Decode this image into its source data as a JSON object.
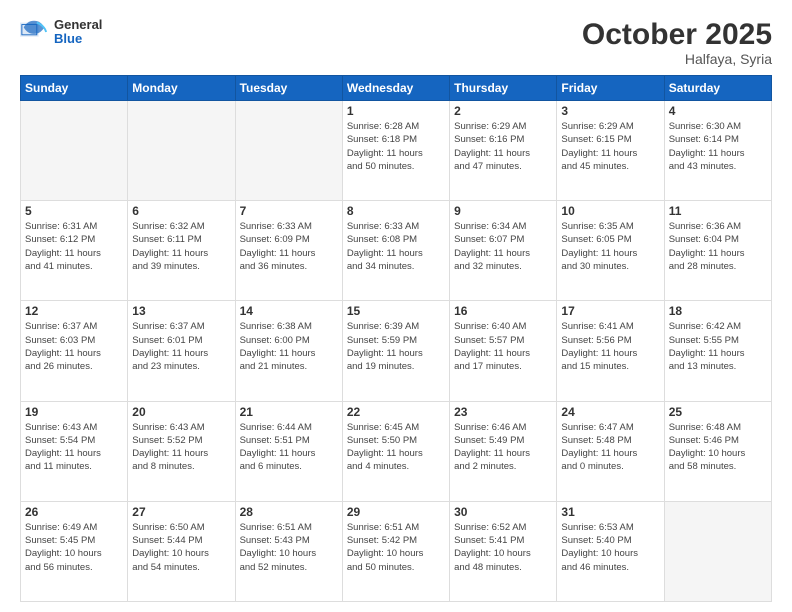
{
  "header": {
    "logo_general": "General",
    "logo_blue": "Blue",
    "month_title": "October 2025",
    "location": "Halfaya, Syria"
  },
  "days_of_week": [
    "Sunday",
    "Monday",
    "Tuesday",
    "Wednesday",
    "Thursday",
    "Friday",
    "Saturday"
  ],
  "weeks": [
    [
      {
        "day": "",
        "info": ""
      },
      {
        "day": "",
        "info": ""
      },
      {
        "day": "",
        "info": ""
      },
      {
        "day": "1",
        "info": "Sunrise: 6:28 AM\nSunset: 6:18 PM\nDaylight: 11 hours\nand 50 minutes."
      },
      {
        "day": "2",
        "info": "Sunrise: 6:29 AM\nSunset: 6:16 PM\nDaylight: 11 hours\nand 47 minutes."
      },
      {
        "day": "3",
        "info": "Sunrise: 6:29 AM\nSunset: 6:15 PM\nDaylight: 11 hours\nand 45 minutes."
      },
      {
        "day": "4",
        "info": "Sunrise: 6:30 AM\nSunset: 6:14 PM\nDaylight: 11 hours\nand 43 minutes."
      }
    ],
    [
      {
        "day": "5",
        "info": "Sunrise: 6:31 AM\nSunset: 6:12 PM\nDaylight: 11 hours\nand 41 minutes."
      },
      {
        "day": "6",
        "info": "Sunrise: 6:32 AM\nSunset: 6:11 PM\nDaylight: 11 hours\nand 39 minutes."
      },
      {
        "day": "7",
        "info": "Sunrise: 6:33 AM\nSunset: 6:09 PM\nDaylight: 11 hours\nand 36 minutes."
      },
      {
        "day": "8",
        "info": "Sunrise: 6:33 AM\nSunset: 6:08 PM\nDaylight: 11 hours\nand 34 minutes."
      },
      {
        "day": "9",
        "info": "Sunrise: 6:34 AM\nSunset: 6:07 PM\nDaylight: 11 hours\nand 32 minutes."
      },
      {
        "day": "10",
        "info": "Sunrise: 6:35 AM\nSunset: 6:05 PM\nDaylight: 11 hours\nand 30 minutes."
      },
      {
        "day": "11",
        "info": "Sunrise: 6:36 AM\nSunset: 6:04 PM\nDaylight: 11 hours\nand 28 minutes."
      }
    ],
    [
      {
        "day": "12",
        "info": "Sunrise: 6:37 AM\nSunset: 6:03 PM\nDaylight: 11 hours\nand 26 minutes."
      },
      {
        "day": "13",
        "info": "Sunrise: 6:37 AM\nSunset: 6:01 PM\nDaylight: 11 hours\nand 23 minutes."
      },
      {
        "day": "14",
        "info": "Sunrise: 6:38 AM\nSunset: 6:00 PM\nDaylight: 11 hours\nand 21 minutes."
      },
      {
        "day": "15",
        "info": "Sunrise: 6:39 AM\nSunset: 5:59 PM\nDaylight: 11 hours\nand 19 minutes."
      },
      {
        "day": "16",
        "info": "Sunrise: 6:40 AM\nSunset: 5:57 PM\nDaylight: 11 hours\nand 17 minutes."
      },
      {
        "day": "17",
        "info": "Sunrise: 6:41 AM\nSunset: 5:56 PM\nDaylight: 11 hours\nand 15 minutes."
      },
      {
        "day": "18",
        "info": "Sunrise: 6:42 AM\nSunset: 5:55 PM\nDaylight: 11 hours\nand 13 minutes."
      }
    ],
    [
      {
        "day": "19",
        "info": "Sunrise: 6:43 AM\nSunset: 5:54 PM\nDaylight: 11 hours\nand 11 minutes."
      },
      {
        "day": "20",
        "info": "Sunrise: 6:43 AM\nSunset: 5:52 PM\nDaylight: 11 hours\nand 8 minutes."
      },
      {
        "day": "21",
        "info": "Sunrise: 6:44 AM\nSunset: 5:51 PM\nDaylight: 11 hours\nand 6 minutes."
      },
      {
        "day": "22",
        "info": "Sunrise: 6:45 AM\nSunset: 5:50 PM\nDaylight: 11 hours\nand 4 minutes."
      },
      {
        "day": "23",
        "info": "Sunrise: 6:46 AM\nSunset: 5:49 PM\nDaylight: 11 hours\nand 2 minutes."
      },
      {
        "day": "24",
        "info": "Sunrise: 6:47 AM\nSunset: 5:48 PM\nDaylight: 11 hours\nand 0 minutes."
      },
      {
        "day": "25",
        "info": "Sunrise: 6:48 AM\nSunset: 5:46 PM\nDaylight: 10 hours\nand 58 minutes."
      }
    ],
    [
      {
        "day": "26",
        "info": "Sunrise: 6:49 AM\nSunset: 5:45 PM\nDaylight: 10 hours\nand 56 minutes."
      },
      {
        "day": "27",
        "info": "Sunrise: 6:50 AM\nSunset: 5:44 PM\nDaylight: 10 hours\nand 54 minutes."
      },
      {
        "day": "28",
        "info": "Sunrise: 6:51 AM\nSunset: 5:43 PM\nDaylight: 10 hours\nand 52 minutes."
      },
      {
        "day": "29",
        "info": "Sunrise: 6:51 AM\nSunset: 5:42 PM\nDaylight: 10 hours\nand 50 minutes."
      },
      {
        "day": "30",
        "info": "Sunrise: 6:52 AM\nSunset: 5:41 PM\nDaylight: 10 hours\nand 48 minutes."
      },
      {
        "day": "31",
        "info": "Sunrise: 6:53 AM\nSunset: 5:40 PM\nDaylight: 10 hours\nand 46 minutes."
      },
      {
        "day": "",
        "info": ""
      }
    ]
  ]
}
